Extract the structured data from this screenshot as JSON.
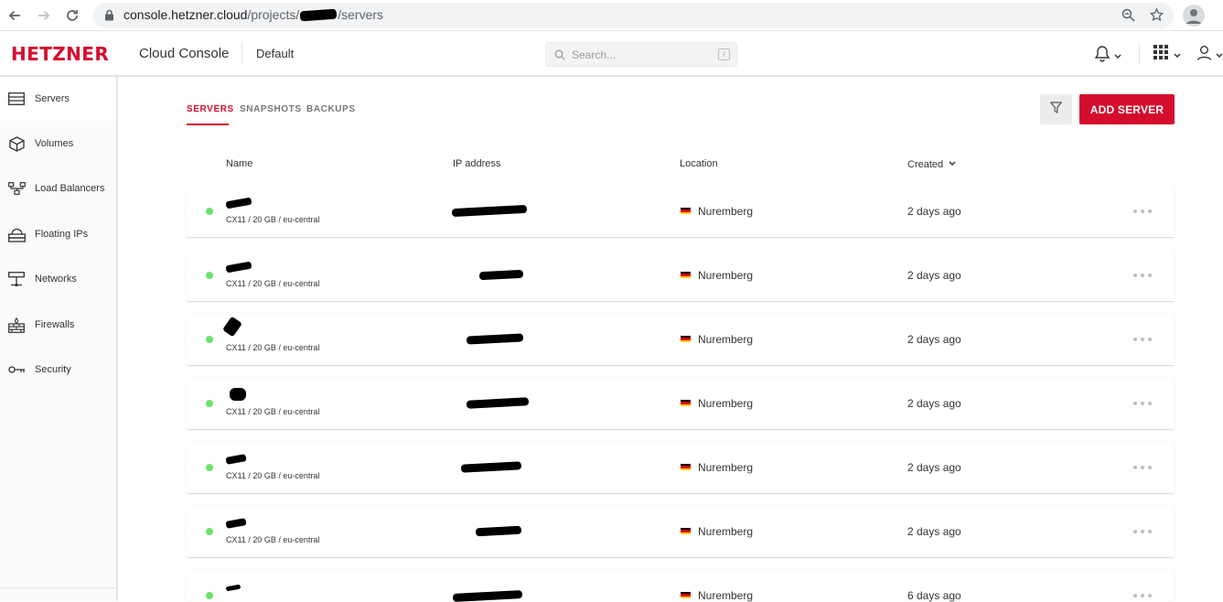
{
  "browser": {
    "url_host": "console.hetzner.cloud",
    "url_path_prefix": "/projects/",
    "url_path_suffix": "/servers"
  },
  "header": {
    "logo": "HETZNER",
    "app_title": "Cloud Console",
    "project": "Default",
    "search_placeholder": "Search...",
    "search_shortcut": "/"
  },
  "sidebar": {
    "items": [
      {
        "label": "Servers",
        "icon": "server-icon",
        "active": true
      },
      {
        "label": "Volumes",
        "icon": "cube-icon",
        "active": false
      },
      {
        "label": "Load Balancers",
        "icon": "load-balancer-icon",
        "active": false
      },
      {
        "label": "Floating IPs",
        "icon": "floating-ip-icon",
        "active": false
      },
      {
        "label": "Networks",
        "icon": "network-icon",
        "active": false
      },
      {
        "label": "Firewalls",
        "icon": "firewall-icon",
        "active": false
      },
      {
        "label": "Security",
        "icon": "key-icon",
        "active": false
      }
    ]
  },
  "tabs": [
    {
      "label": "SERVERS",
      "active": true
    },
    {
      "label": "SNAPSHOTS",
      "active": false
    },
    {
      "label": "BACKUPS",
      "active": false
    }
  ],
  "toolbar": {
    "add_server": "ADD SERVER"
  },
  "table": {
    "columns": {
      "name": "Name",
      "ip": "IP address",
      "location": "Location",
      "created": "Created"
    },
    "rows": [
      {
        "name": "",
        "spec": "CX11 / 20 GB / eu-central",
        "ip": "",
        "location": "Nuremberg",
        "created": "2 days ago",
        "status": "running"
      },
      {
        "name": "",
        "spec": "CX11 / 20 GB / eu-central",
        "ip": "",
        "location": "Nuremberg",
        "created": "2 days ago",
        "status": "running"
      },
      {
        "name": "",
        "spec": "CX11 / 20 GB / eu-central",
        "ip": "",
        "location": "Nuremberg",
        "created": "2 days ago",
        "status": "running"
      },
      {
        "name": "",
        "spec": "CX11 / 20 GB / eu-central",
        "ip": "",
        "location": "Nuremberg",
        "created": "2 days ago",
        "status": "running"
      },
      {
        "name": "",
        "spec": "CX11 / 20 GB / eu-central",
        "ip": "",
        "location": "Nuremberg",
        "created": "2 days ago",
        "status": "running"
      },
      {
        "name": "",
        "spec": "CX11 / 20 GB / eu-central",
        "ip": "",
        "location": "Nuremberg",
        "created": "2 days ago",
        "status": "running"
      },
      {
        "name": "",
        "spec": "",
        "ip": "",
        "location": "Nuremberg",
        "created": "6 days ago",
        "status": "running"
      }
    ]
  },
  "colors": {
    "brand": "#d50c2d",
    "status_running": "#6de06d"
  }
}
